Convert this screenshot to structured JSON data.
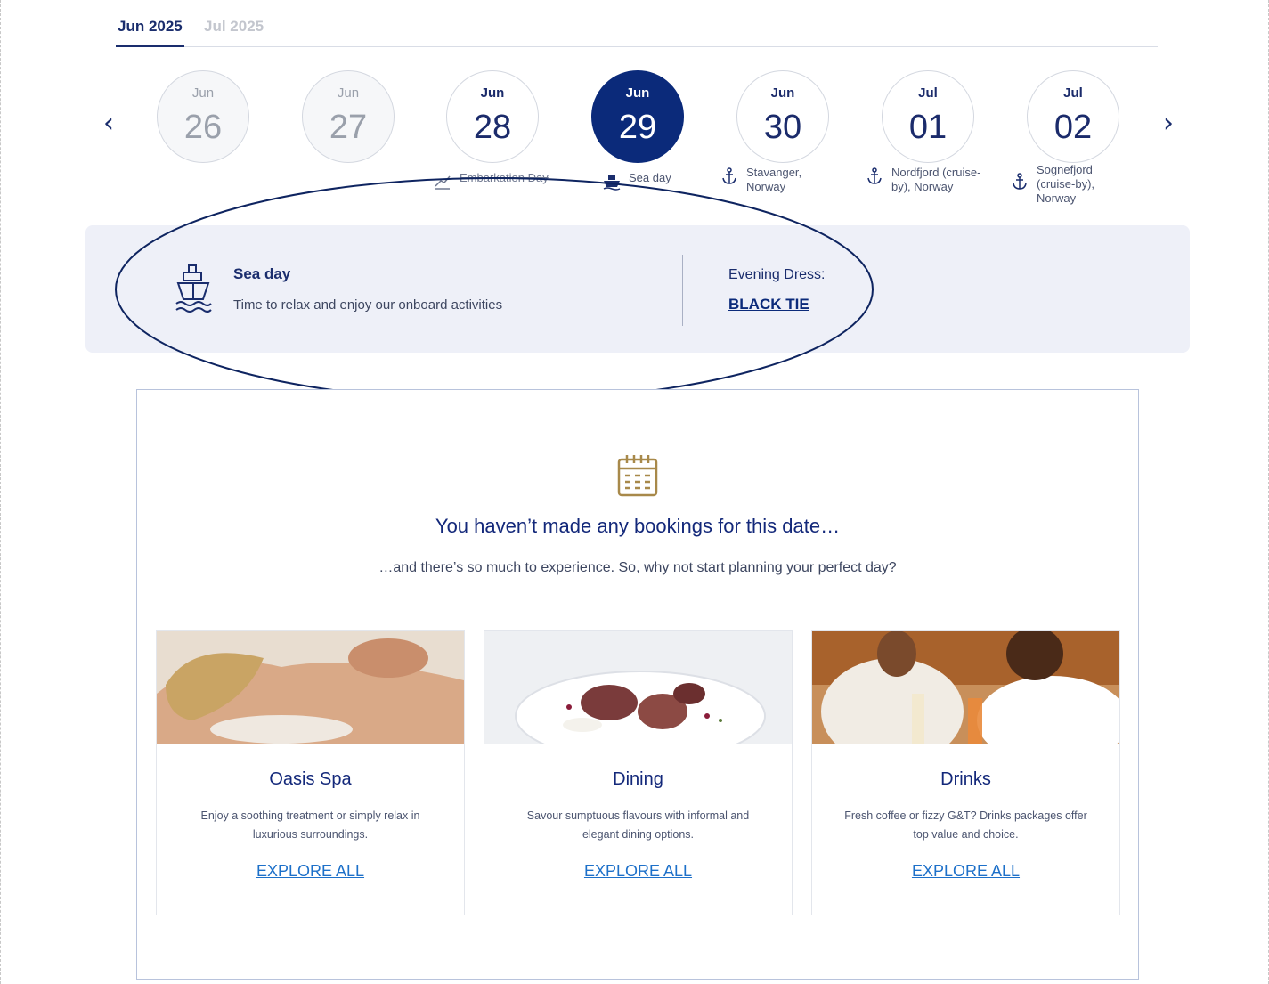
{
  "month_tabs": [
    {
      "label": "Jun 2025",
      "active": true
    },
    {
      "label": "Jul 2025",
      "active": false
    }
  ],
  "days": [
    {
      "month": "Jun",
      "day": "26",
      "state": "past",
      "caption": ""
    },
    {
      "month": "Jun",
      "day": "27",
      "state": "past",
      "caption": ""
    },
    {
      "month": "Jun",
      "day": "28",
      "state": "normal",
      "caption": "Embarkation Day",
      "icon": "embarkation-icon"
    },
    {
      "month": "Jun",
      "day": "29",
      "state": "selected",
      "caption": "Sea day",
      "icon": "ship-icon"
    },
    {
      "month": "Jun",
      "day": "30",
      "state": "normal",
      "caption": "Stavanger, Norway",
      "icon": "anchor-icon"
    },
    {
      "month": "Jul",
      "day": "01",
      "state": "normal",
      "caption": "Nordfjord (cruise-by), Norway",
      "icon": "anchor-icon"
    },
    {
      "month": "Jul",
      "day": "02",
      "state": "normal",
      "caption": "Sognefjord (cruise-by), Norway",
      "icon": "anchor-icon"
    }
  ],
  "seaday": {
    "title": "Sea day",
    "description": "Time to relax and enjoy our onboard activities",
    "dress_label": "Evening Dress:",
    "dress_value": "BLACK TIE"
  },
  "bookings": {
    "title": "You haven’t made any bookings for this date…",
    "subtitle": "…and there’s so much to experience. So, why not start planning your perfect day?"
  },
  "cards": [
    {
      "title": "Oasis Spa",
      "description": "Enjoy a soothing treatment or simply relax in luxurious surroundings.",
      "link": "EXPLORE ALL"
    },
    {
      "title": "Dining",
      "description": "Savour sumptuous flavours with informal and elegant dining options.",
      "link": "EXPLORE ALL"
    },
    {
      "title": "Drinks",
      "description": "Fresh coffee or fizzy G&T? Drinks packages offer top value and choice.",
      "link": "EXPLORE ALL"
    }
  ],
  "colors": {
    "navy": "#0b2a7a",
    "panel_bg": "#eef0f8",
    "link_blue": "#1d70c9",
    "calendar_gold": "#a8894a"
  }
}
